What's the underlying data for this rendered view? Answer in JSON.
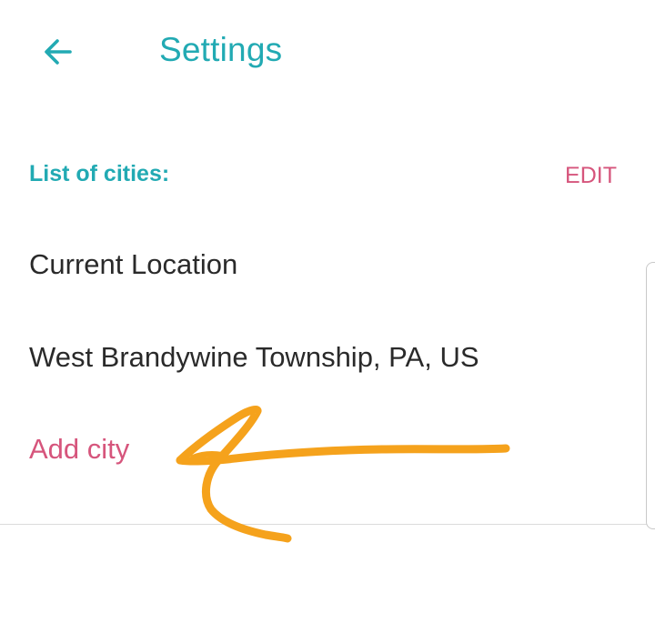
{
  "header": {
    "title": "Settings",
    "back_icon": "arrow-left-icon"
  },
  "cities": {
    "section_label": "List of cities:",
    "edit_label": "EDIT",
    "items": [
      {
        "label": "Current Location"
      },
      {
        "label": "West Brandywine Township, PA, US"
      }
    ],
    "add_label": "Add city"
  },
  "colors": {
    "accent_teal": "#22aab3",
    "accent_pink": "#d6557c",
    "annotation_orange": "#f5a21c"
  }
}
